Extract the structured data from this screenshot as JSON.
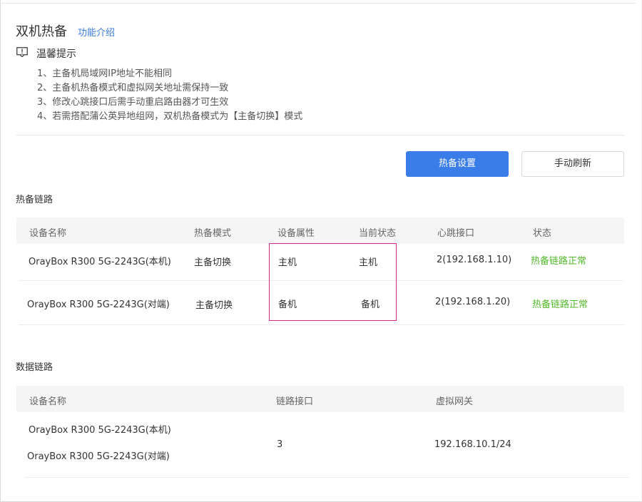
{
  "header": {
    "title": "双机热备",
    "intro_link": "功能介绍"
  },
  "tips": {
    "title": "温馨提示",
    "items": [
      "1、主备机局域网IP地址不能相同",
      "2、主备机热备模式和虚拟网关地址需保持一致",
      "3、修改心跳接口后需手动重启路由器才可生效",
      "4、若需搭配蒲公英异地组网，双机热备模式为【主备切换】模式"
    ]
  },
  "actions": {
    "hot_standby_settings": "热备设置",
    "manual_refresh": "手动刷新"
  },
  "hot_standby_link": {
    "title": "热备链路",
    "columns": [
      "设备名称",
      "热备模式",
      "设备属性",
      "当前状态",
      "心跳接口",
      "状态"
    ],
    "rows": [
      {
        "device": "OrayBox R300 5G-2243G(本机)",
        "mode": "主备切换",
        "attribute": "主机",
        "current": "主机",
        "heartbeat": "2(192.168.1.10)",
        "status": "热备链路正常"
      },
      {
        "device": "OrayBox R300 5G-2243G(对端)",
        "mode": "主备切换",
        "attribute": "备机",
        "current": "备机",
        "heartbeat": "2(192.168.1.20)",
        "status": "热备链路正常"
      }
    ]
  },
  "data_link": {
    "title": "数据链路",
    "columns": [
      "设备名称",
      "链路接口",
      "虚拟网关"
    ],
    "row": {
      "device_local": "OrayBox R300 5G-2243G(本机)",
      "device_peer": "OrayBox R300 5G-2243G(对端)",
      "interface": "3",
      "gateway": "192.168.10.1/24"
    }
  },
  "colors": {
    "accent": "#3b7de8",
    "ok": "#52b92a",
    "highlight": "#d7268c"
  }
}
